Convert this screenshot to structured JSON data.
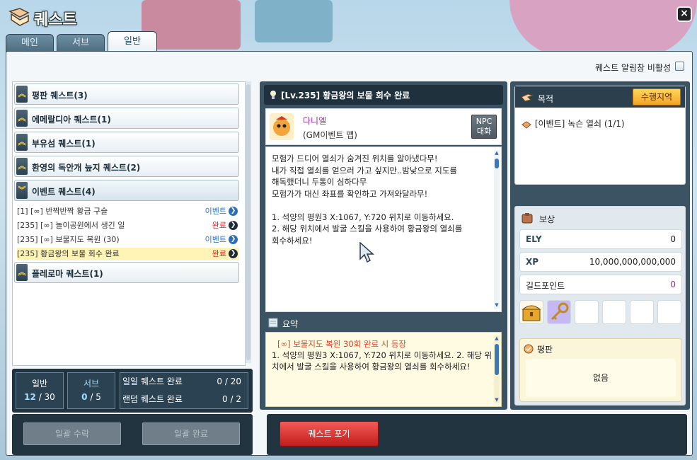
{
  "window": {
    "title": "퀘스트",
    "close_label": "×"
  },
  "tabs": [
    {
      "label": "메인",
      "active": false
    },
    {
      "label": "서브",
      "active": false
    },
    {
      "label": "일반",
      "active": true
    }
  ],
  "alarm": {
    "label": "퀘스트 알림창 비활성",
    "checked": false
  },
  "categories": [
    {
      "name": "평판 퀘스트(3)",
      "open": false
    },
    {
      "name": "에메랄디아 퀘스트(1)",
      "open": false
    },
    {
      "name": "부유섬 퀘스트(1)",
      "open": false
    },
    {
      "name": "환영의 독안개 늪지 퀘스트(2)",
      "open": false
    },
    {
      "name": "이벤트 퀘스트(4)",
      "open": true
    },
    {
      "name": "플레로마 퀘스트(1)",
      "open": false
    }
  ],
  "event_quests": [
    {
      "name": "[1] [∞] 반짝반짝 황금 구슬",
      "status": "이벤트",
      "status_color": "#2d6fb6",
      "selected": false
    },
    {
      "name": "[235] [∞] 놀이공원에서 생긴 일",
      "status": "완료",
      "status_color": "#d42a2a",
      "selected": false
    },
    {
      "name": "[235]  [∞] 보물지도 복원 (30)",
      "status": "이벤트",
      "status_color": "#2d6fb6",
      "selected": false
    },
    {
      "name": "[235] 황금왕의 보물 회수 완료",
      "status": "완료",
      "status_color": "#d42a2a",
      "selected": true
    }
  ],
  "stats": {
    "general": {
      "label": "일반",
      "current": "12",
      "max": "/ 30"
    },
    "sub": {
      "label": "서브",
      "current": "0",
      "max": "/ 5"
    },
    "daily": {
      "label": "일일 퀘스트 완료",
      "value": "0 / 20"
    },
    "random": {
      "label": "랜덤 퀘스트 완료",
      "value": "0 / 2"
    }
  },
  "bottom_buttons": {
    "accept_all": "일괄 수락",
    "complete_all": "일괄 완료",
    "give_up": "퀘스트 포기"
  },
  "quest": {
    "title": "[Lv.235] 황금왕의 보물 회수 완료",
    "npc_name": "다니엘",
    "npc_location": "(GM이벤트 맵)",
    "npc_button": "NPC 대화",
    "description": "모험가 드디어 열쇠가 숨겨진 위치를 알아냈다무!\n내가 직접 열쇠를 얻으러 가고 싶지만..밤낮으로 지도를\n해독했더니 두통이 심하다무\n모험가가 대신 좌표를 확인하고 가져와달라무!\n\n1. 석양의 평원3 X:1067, Y:720 위치로 이동하세요.\n2. 해당 위치에서 발굴 스킬을 사용하여 황금왕의 열쇠를\n회수하세요!",
    "summary_label": "요약",
    "summary_title": "[∞] 보물지도 복원 30회 완료 시 등장",
    "summary_text": "1. 석양의 평원3 X:1067, Y:720 위치로 이동하세요. 2. 해당 위치에서 발굴 스킬을 사용하여 황금왕의 열쇠를 회수하세요!"
  },
  "goal": {
    "label": "목적",
    "button": "수행지역",
    "item": "[이벤트] 녹슨 열쇠 (1/1)"
  },
  "reward": {
    "label": "보상",
    "ely": {
      "label": "ELY",
      "value": "0"
    },
    "xp": {
      "label": "XP",
      "value": "10,000,000,000,000"
    },
    "guild": {
      "label": "길드포인트",
      "value": "0"
    },
    "fame_label": "평판",
    "fame_value": "없음"
  },
  "colors": {
    "accent_red": "#c21d1d",
    "panel_dark": "#3c5363",
    "guild_value": "#8b2ca8"
  }
}
